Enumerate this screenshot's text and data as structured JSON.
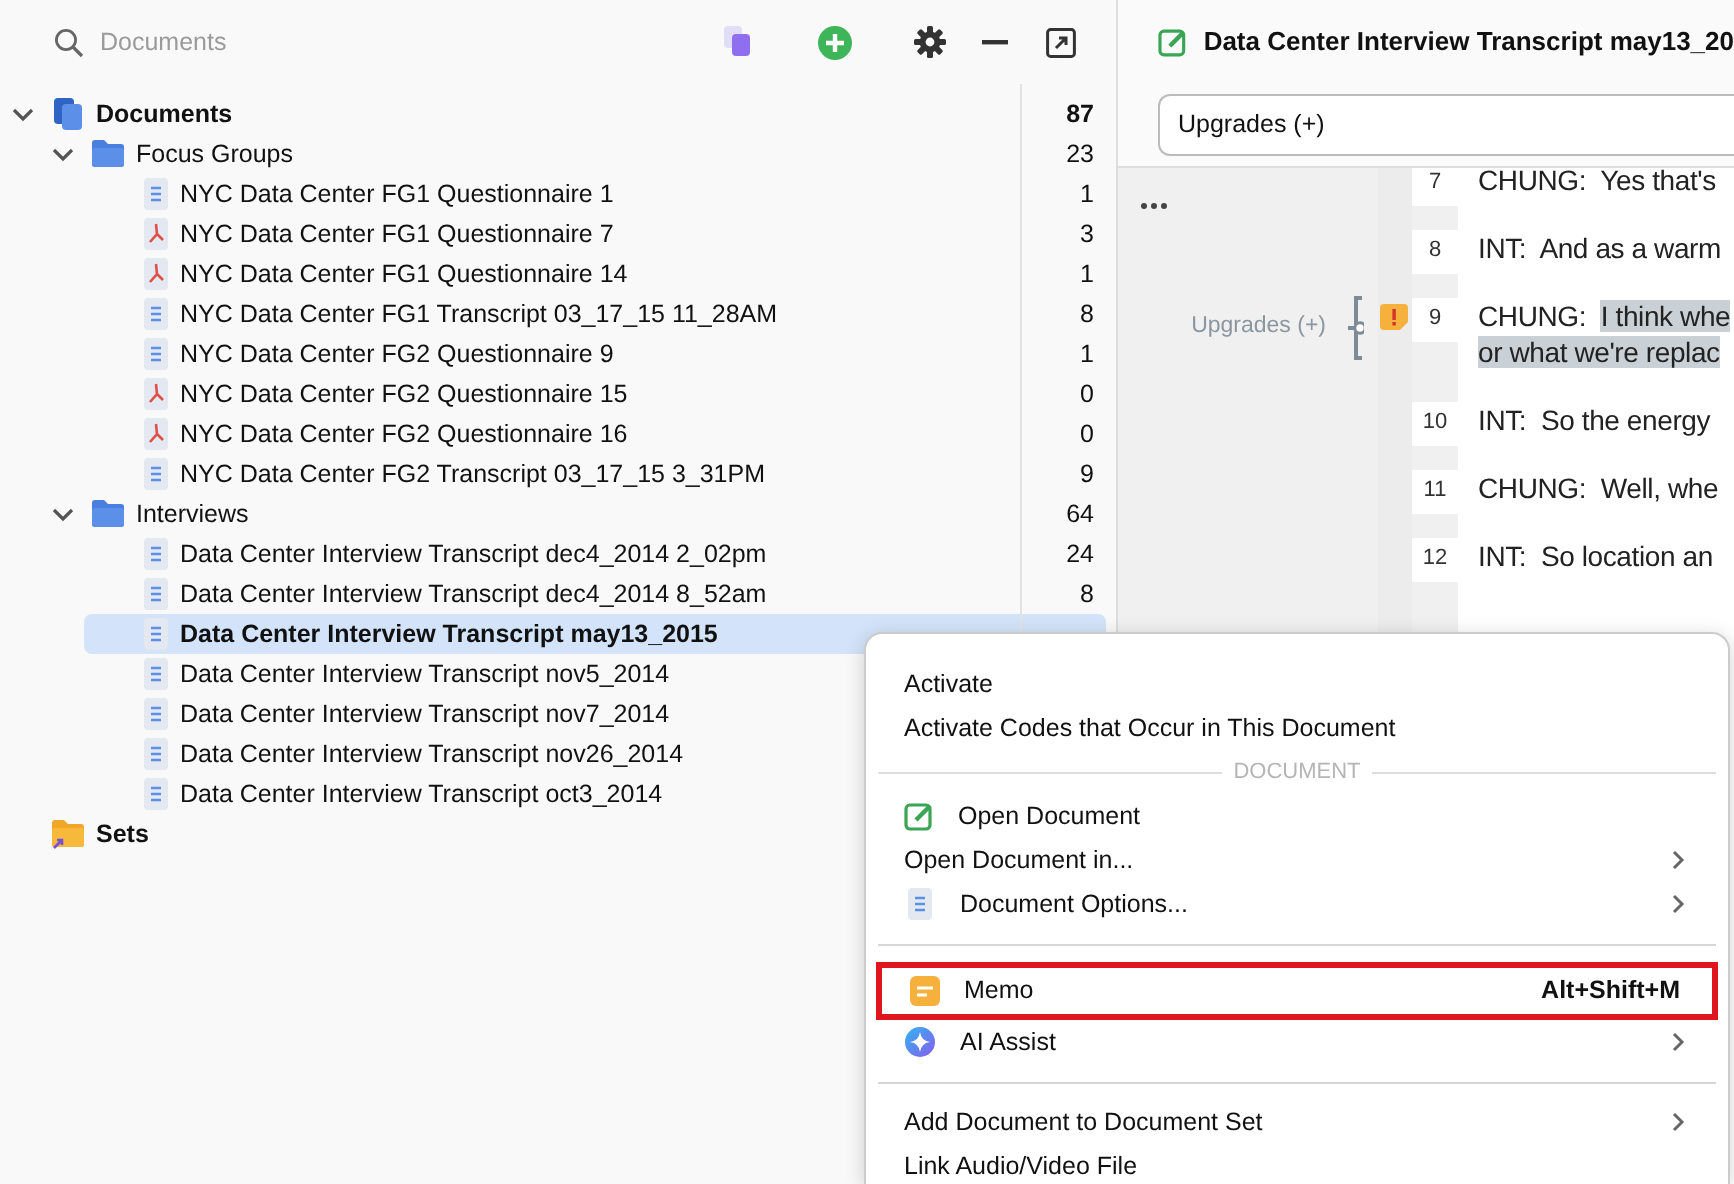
{
  "sidebar": {
    "search": {
      "placeholder": "Documents"
    },
    "tree": [
      {
        "label": "Documents",
        "count": "87",
        "kind": "documents",
        "expanded": true,
        "selected": false,
        "children": [
          {
            "label": "Focus Groups",
            "count": "23",
            "kind": "folder",
            "expanded": true,
            "selected": false,
            "children": [
              {
                "label": "NYC Data Center FG1 Questionnaire 1",
                "count": "1",
                "kind": "text",
                "selected": false
              },
              {
                "label": "NYC Data Center FG1 Questionnaire 7",
                "count": "3",
                "kind": "pdf",
                "selected": false
              },
              {
                "label": "NYC Data Center FG1 Questionnaire 14",
                "count": "1",
                "kind": "pdf",
                "selected": false
              },
              {
                "label": "NYC Data Center FG1 Transcript 03_17_15 11_28AM",
                "count": "8",
                "kind": "text",
                "selected": false
              },
              {
                "label": "NYC Data Center FG2 Questionnaire 9",
                "count": "1",
                "kind": "text",
                "selected": false
              },
              {
                "label": "NYC Data Center FG2 Questionnaire 15",
                "count": "0",
                "kind": "pdf",
                "selected": false
              },
              {
                "label": "NYC Data Center FG2 Questionnaire 16",
                "count": "0",
                "kind": "pdf",
                "selected": false
              },
              {
                "label": "NYC Data Center FG2 Transcript 03_17_15 3_31PM",
                "count": "9",
                "kind": "text",
                "selected": false
              }
            ]
          },
          {
            "label": "Interviews",
            "count": "64",
            "kind": "folder",
            "expanded": true,
            "selected": false,
            "children": [
              {
                "label": "Data Center Interview Transcript dec4_2014 2_02pm",
                "count": "24",
                "kind": "text",
                "selected": false
              },
              {
                "label": "Data Center Interview Transcript dec4_2014 8_52am",
                "count": "8",
                "kind": "text",
                "selected": false
              },
              {
                "label": "Data Center Interview Transcript may13_2015",
                "kind": "text",
                "selected": true
              },
              {
                "label": "Data Center Interview Transcript nov5_2014",
                "kind": "text",
                "selected": false
              },
              {
                "label": "Data Center Interview Transcript nov7_2014",
                "kind": "text",
                "selected": false
              },
              {
                "label": "Data Center Interview Transcript nov26_2014",
                "kind": "text",
                "selected": false
              },
              {
                "label": "Data Center Interview Transcript oct3_2014",
                "kind": "text",
                "selected": false
              }
            ]
          }
        ]
      },
      {
        "label": "Sets",
        "kind": "set",
        "selected": false
      }
    ]
  },
  "document": {
    "title": "Data Center Interview Transcript may13_20",
    "code_filter": "Upgrades (+)",
    "margin_code": "Upgrades (+)",
    "lines": [
      {
        "number": "7",
        "rows": [
          [
            {
              "text": "CHUNG:  Yes that's",
              "coded": false
            }
          ]
        ]
      },
      {
        "number": "8",
        "rows": [
          [
            {
              "text": "INT:  And as a warm",
              "coded": false
            }
          ]
        ]
      },
      {
        "number": "9",
        "memo": true,
        "rows": [
          [
            {
              "text": "CHUNG:  ",
              "coded": false
            },
            {
              "text": "I think whe",
              "coded": true
            }
          ],
          [
            {
              "text": "or what we're replac",
              "coded": true
            }
          ]
        ]
      },
      {
        "number": "10",
        "rows": [
          [
            {
              "text": "INT:  So the energy",
              "coded": false
            }
          ]
        ]
      },
      {
        "number": "11",
        "rows": [
          [
            {
              "text": "CHUNG:  Well, whe",
              "coded": false
            }
          ]
        ]
      },
      {
        "number": "12",
        "rows": [
          [
            {
              "text": "INT:  So location an",
              "coded": false
            }
          ]
        ]
      }
    ]
  },
  "context_menu": [
    {
      "kind": "plain",
      "label": "Activate"
    },
    {
      "kind": "plain",
      "label": "Activate Codes that Occur in This Document"
    },
    {
      "kind": "header",
      "label": "DOCUMENT"
    },
    {
      "kind": "edit",
      "label": "Open Document"
    },
    {
      "kind": "plain",
      "label": "Open Document in...",
      "submenu": true
    },
    {
      "kind": "doc",
      "label": "Document Options...",
      "submenu": true
    },
    {
      "kind": "divider"
    },
    {
      "kind": "memo",
      "label": "Memo",
      "shortcut": "Alt+Shift+M",
      "highlighted": true
    },
    {
      "kind": "ai",
      "label": "AI Assist",
      "submenu": true
    },
    {
      "kind": "divider"
    },
    {
      "kind": "plain",
      "label": "Add Document to Document Set",
      "submenu": true
    },
    {
      "kind": "plain",
      "label": "Link Audio/Video File"
    }
  ]
}
